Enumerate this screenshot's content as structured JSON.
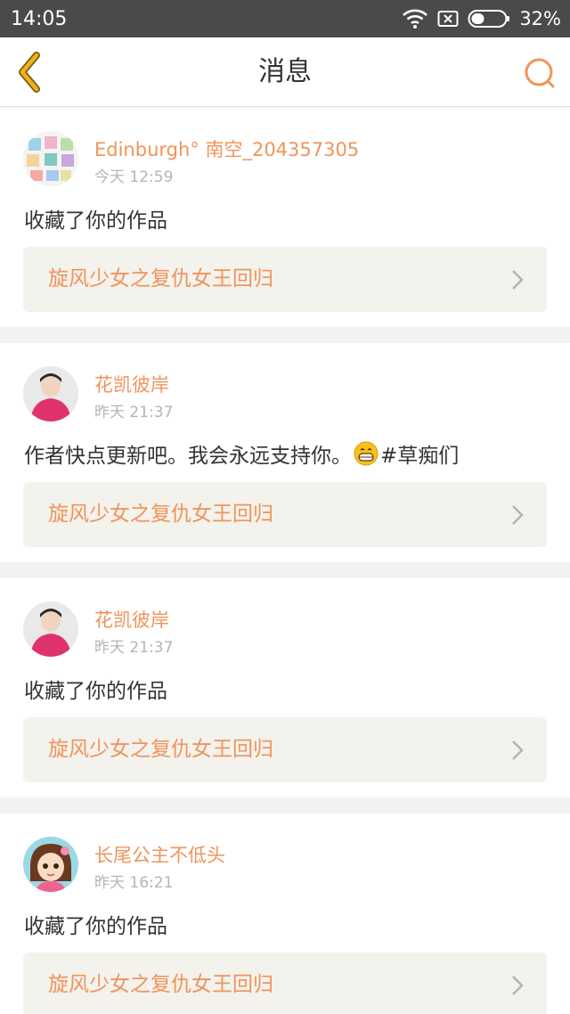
{
  "status_bar": {
    "time": "14:05",
    "battery": "32%",
    "icons": [
      "wifi-icon",
      "no-sim-icon",
      "battery-icon"
    ]
  },
  "header": {
    "title": "消息",
    "back_icon": "chevron-left-icon",
    "search_icon": "search-icon"
  },
  "colors": {
    "accent": "#f0945a",
    "back_arrow": "#f2b01e",
    "status_bar": "#4a4a4a"
  },
  "messages": [
    {
      "username": "Edinburgh° 南空_204357305",
      "time": "今天 12:59",
      "text": "收藏了你的作品",
      "work": "旋风少女之复仇女王回归"
    },
    {
      "username": "花凯彼岸",
      "time": "昨天 21:37",
      "text_before": "作者快点更新吧。我会永远支持你。",
      "emoji": "grinning-face-emoji",
      "text_after": "#草痴们",
      "work": "旋风少女之复仇女王回归"
    },
    {
      "username": "花凯彼岸",
      "time": "昨天 21:37",
      "text": "收藏了你的作品",
      "work": "旋风少女之复仇女王回归"
    },
    {
      "username": "长尾公主不低头",
      "time": "昨天 16:21",
      "text": "收藏了你的作品",
      "work": "旋风少女之复仇女王回归"
    }
  ]
}
